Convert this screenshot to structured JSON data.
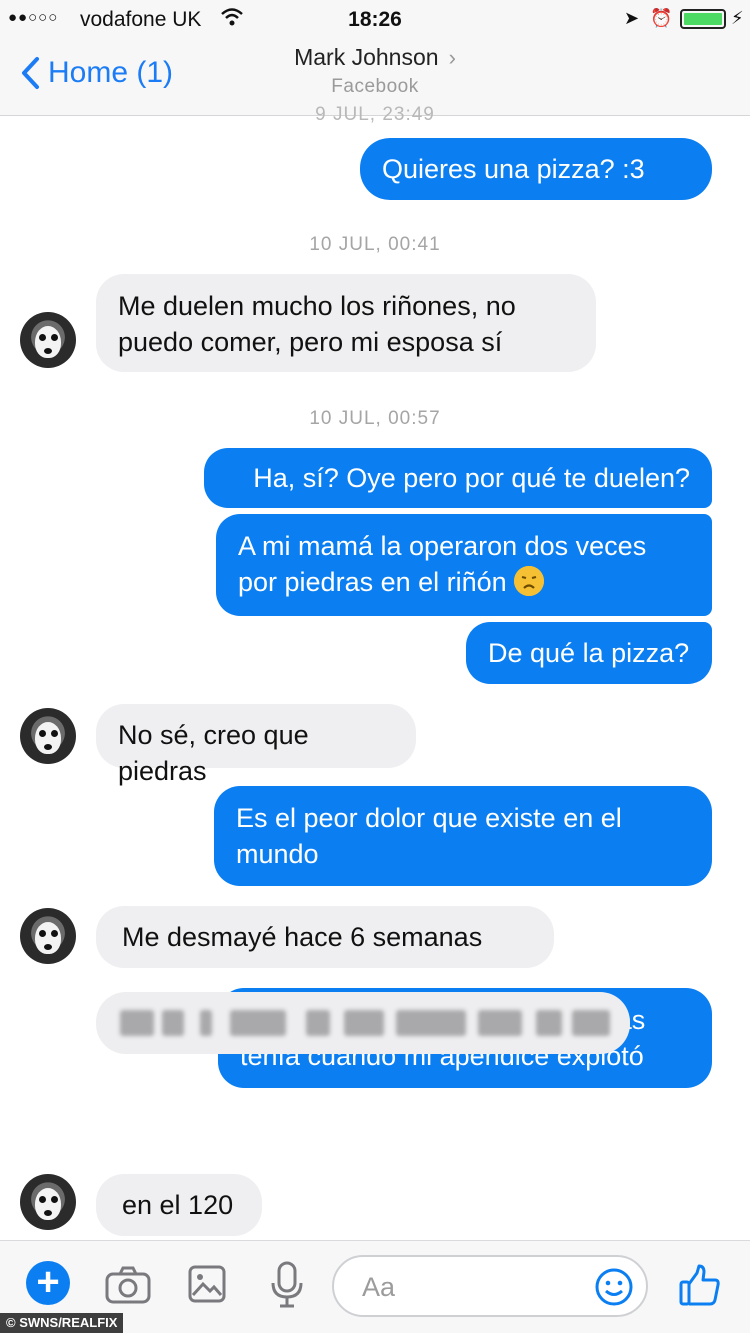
{
  "status_bar": {
    "signal": "●●○○○",
    "carrier": "vodafone UK",
    "time": "18:26"
  },
  "nav": {
    "back_label": "Home (1)",
    "contact_name": "Mark Johnson",
    "contact_source": "Facebook"
  },
  "thread": {
    "timestamp_top_cut": "9 JUL, 23:49",
    "timestamp_1": "10 JUL, 00:41",
    "timestamp_2": "10 JUL, 00:57",
    "messages": [
      {
        "from": "me",
        "text": "Quieres una pizza? :3"
      },
      {
        "from": "them",
        "text": "Me duelen mucho los riñones, no puedo comer, pero mi esposa sí"
      },
      {
        "from": "me",
        "text": "Ha, sí? Oye pero por qué te duelen?"
      },
      {
        "from": "me",
        "text": "A mi mamá la operaron dos veces por piedras en el riñón"
      },
      {
        "from": "me",
        "text": "De qué la pizza?"
      },
      {
        "from": "them",
        "text": "No sé, creo que piedras"
      },
      {
        "from": "me",
        "text": "Es el peor dolor que existe en el mundo"
      },
      {
        "from": "them",
        "text": "Me desmayé hace 6 semanas"
      },
      {
        "from": "me",
        "text": "Los doctores pensaron que yo las tenía cuando mi apéndice explotó"
      },
      {
        "from": "them",
        "text": "[blurred message]"
      },
      {
        "from": "them",
        "text": "en el 120"
      }
    ]
  },
  "composer": {
    "placeholder": "Aa"
  },
  "watermark": "© SWNS/REALFIX",
  "colors": {
    "accent": "#0b7ff2",
    "incoming_bubble": "#efeff1"
  }
}
